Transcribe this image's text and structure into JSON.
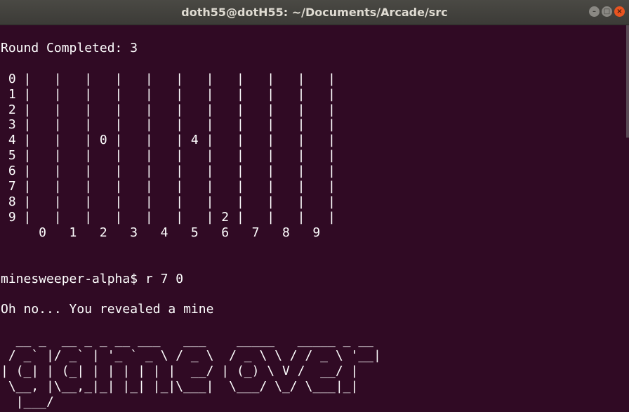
{
  "window": {
    "title": "doth55@dotH55: ~/Documents/Arcade/src",
    "controls": {
      "minimize": "–",
      "maximize": "□",
      "close": "×"
    }
  },
  "terminal": {
    "lines": [
      "",
      "Round Completed: 3",
      "",
      " 0 |   |   |   |   |   |   |   |   |   |   |",
      " 1 |   |   |   |   |   |   |   |   |   |   |",
      " 2 |   |   |   |   |   |   |   |   |   |   |",
      " 3 |   |   |   |   |   |   |   |   |   |   |",
      " 4 |   |   | 0 |   |   | 4 |   |   |   |   |",
      " 5 |   |   |   |   |   |   |   |   |   |   |",
      " 6 |   |   |   |   |   |   |   |   |   |   |",
      " 7 |   |   |   |   |   |   |   |   |   |   |",
      " 8 |   |   |   |   |   |   |   |   |   |   |",
      " 9 |   |   |   |   |   |   | 2 |   |   |   |",
      "     0   1   2   3   4   5   6   7   8   9",
      "",
      "",
      "minesweeper-alpha$ r 7 0",
      "",
      "Oh no... You revealed a mine",
      "",
      "  __ _  __ _ _ __ ___   ___    _____   _____ _ __",
      " / _` |/ _` | '_ ` _ \\ / _ \\  / _ \\ \\ / / _ \\ '__|",
      "| (_| | (_| | | | | | |  __/ | (_) \\ V /  __/ |",
      " \\__, |\\__,_|_| |_| |_|\\___|  \\___/ \\_/ \\___|_|",
      "  |___/"
    ]
  }
}
